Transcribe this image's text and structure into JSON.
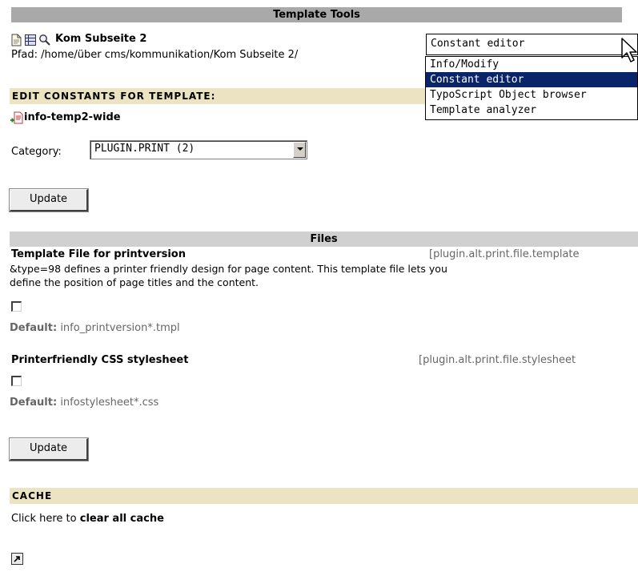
{
  "header": {
    "title": "Template Tools"
  },
  "page": {
    "name": "Kom Subseite 2",
    "path": "Pfad: /home/über cms/kommunikation/Kom Subseite 2/"
  },
  "function_menu": {
    "selected": "Constant editor",
    "options": [
      "Info/Modify",
      "Constant editor",
      "TypoScript Object browser",
      "Template analyzer"
    ]
  },
  "edit_section": {
    "heading": "EDIT CONSTANTS FOR TEMPLATE:",
    "template_name": "info-temp2-wide",
    "category_label": "Category:",
    "category_value": "PLUGIN.PRINT (2)",
    "update_label": "Update"
  },
  "files_section": {
    "heading": "Files",
    "items": [
      {
        "title": "Template File for printversion",
        "key": "[plugin.alt.print.file.template",
        "desc1": "&type=98 defines a printer friendly design for page content. This template file lets you",
        "desc2": "define the position of page titles and the content.",
        "default_label": "Default:",
        "default_value": "info_printversion*.tmpl"
      },
      {
        "title": "Printerfriendly CSS stylesheet",
        "key": "[plugin.alt.print.file.stylesheet",
        "default_label": "Default:",
        "default_value": "infostylesheet*.css"
      }
    ],
    "update_label": "Update"
  },
  "cache_section": {
    "heading": "CACHE",
    "text_prefix": "Click here to",
    "link_label": "clear all cache"
  }
}
